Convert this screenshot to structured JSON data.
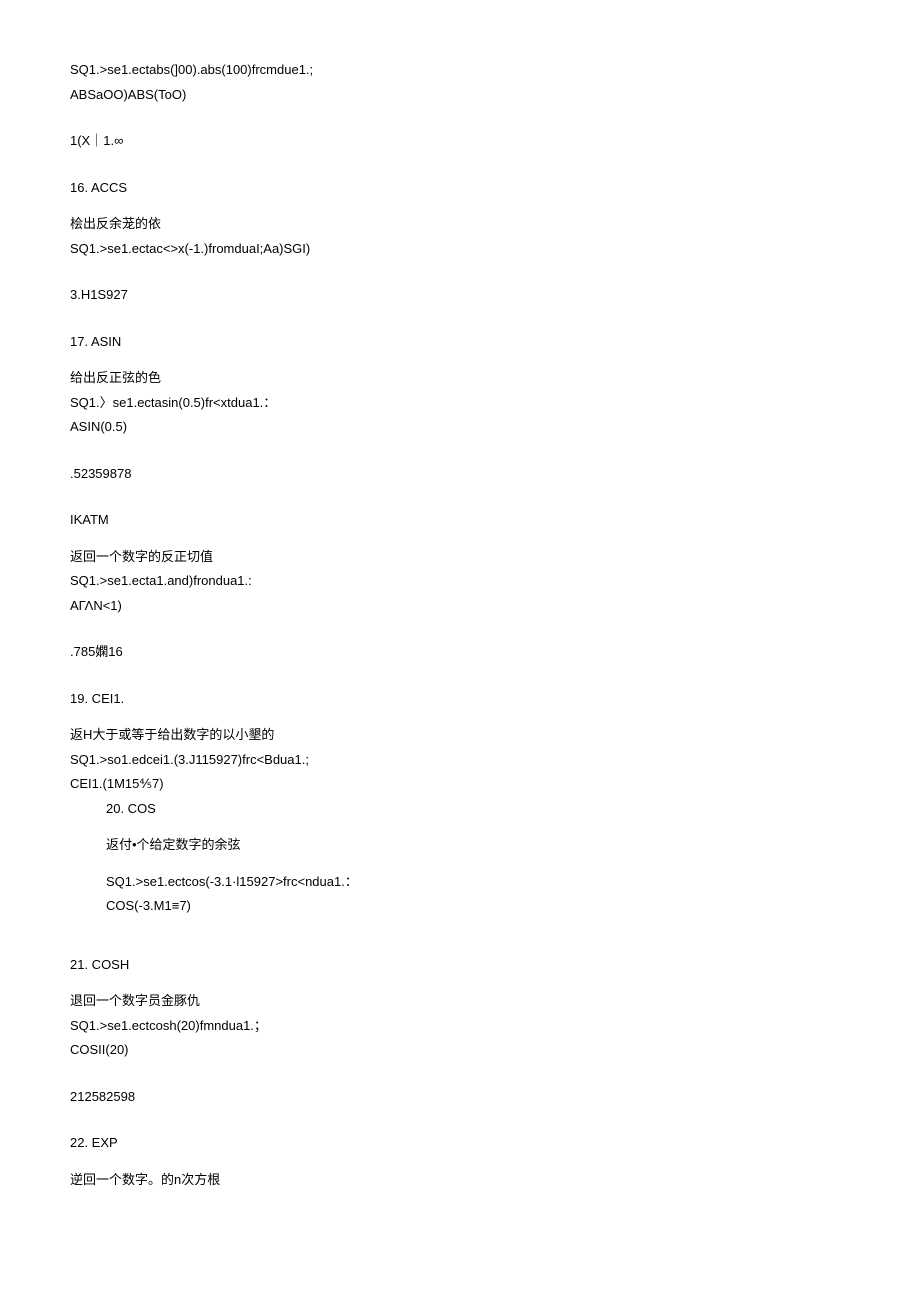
{
  "block1": {
    "l1": "SQ1.>se1.ectabs(]00).abs(100)frcmdue1.;",
    "l2": "ABSaOO)ABS(ToO)",
    "l3": "1(X｜1.∞"
  },
  "s16": {
    "num": "16.    ACCS",
    "desc": "桧出反余茏的依",
    "sql": "SQ1.>se1.ectac<>x(-1.)fromduaI;Aa)SGI)",
    "out": "3.H1S927"
  },
  "s17": {
    "num": "17.    ASIN",
    "desc": "给出反正弦的色",
    "sql": "SQ1.〉se1.ectasin(0.5)fr<xtdua1.：",
    "sql2": "ASIN(0.5)",
    "out": ".52359878"
  },
  "s18": {
    "num": "IKATM",
    "desc": "返回一个数字的反正切值",
    "sql": "SQ1.>se1.ecta1.and)frondua1.:",
    "sql2": "AΓΛN<1)",
    "out": ".785嫻16"
  },
  "s19": {
    "num": "19.    CEI1.",
    "desc": "返H大于或等于给出数字的以小墾的",
    "sql": "SQ1.>so1.edcei1.(3.J115927)frc<Bdua1.;",
    "out": "CEI1.(1M15⅘7)"
  },
  "s20": {
    "num": "20.    COS",
    "desc": "返付•个给定数字的余弦",
    "sql": "SQ1.>se1.ectcos(-3.1·l15927>frc<ndua1.：",
    "out": "COS(-3.M1≡7)"
  },
  "s21": {
    "num": "21.    COSH",
    "desc": "退回一个数字员金豚仇",
    "sql": "SQ1.>se1.ectcosh(20)fmndua1.；",
    "sql2": "COSII(20)",
    "out": "212582598"
  },
  "s22": {
    "num": "22.    EXP",
    "desc": "逆回一个数字。的n次方根"
  }
}
